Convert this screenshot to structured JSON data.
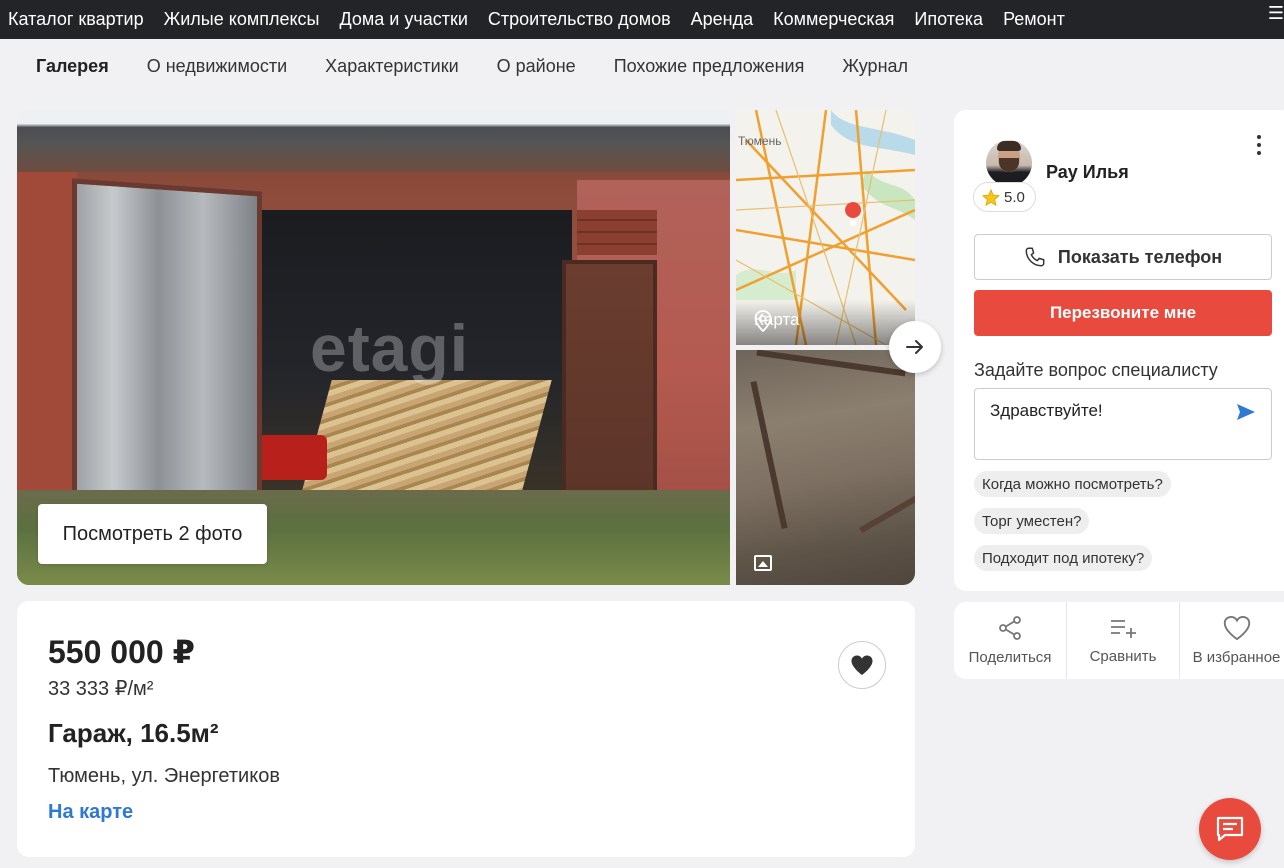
{
  "topnav": {
    "items": [
      "Каталог квартир",
      "Жилые комплексы",
      "Дома и участки",
      "Строительство домов",
      "Аренда",
      "Коммерческая",
      "Ипотека",
      "Ремонт"
    ],
    "menu_icon": "hamburger-icon"
  },
  "subtabs": {
    "items": [
      "Галерея",
      "О недвижимости",
      "Характеристики",
      "О районе",
      "Похожие предложения",
      "Журнал"
    ],
    "active": "Галерея"
  },
  "gallery": {
    "watermark": "etagi",
    "view_photos_label": "Посмотреть 2 фото",
    "map_label": "Карта",
    "map_city": "Тюмень",
    "next_icon": "arrow-right-icon",
    "image_icon": "image-icon"
  },
  "listing": {
    "price": "550 000 ₽",
    "price_per_m2": "33 333 ₽/м²",
    "title": "Гараж, 16.5м²",
    "address": "Тюмень, ул. Энергетиков",
    "map_link": "На карте"
  },
  "agent": {
    "name": "Рау Илья",
    "rating": "5.0",
    "show_phone_label": "Показать телефон",
    "callback_label": "Перезвоните мне",
    "ask_label": "Задайте вопрос специалисту",
    "message_value": "Здравствуйте!",
    "quick_questions": [
      "Когда можно посмотреть?",
      "Торг уместен?",
      "Подходит под ипотеку?"
    ]
  },
  "actions": {
    "share": "Поделиться",
    "compare": "Сравнить",
    "favorite": "В избранное"
  },
  "colors": {
    "accent": "#e84b3e",
    "link": "#2f78d3",
    "nav_bg": "#232427",
    "page_bg": "#f1f1f3",
    "map_road": "#f0a030",
    "map_pin": "#e84b3e"
  }
}
